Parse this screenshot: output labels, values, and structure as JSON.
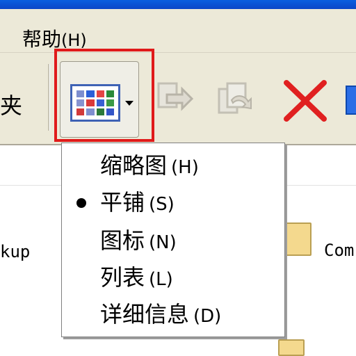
{
  "menubar": {
    "help_label": "帮助",
    "help_accel": "(H)"
  },
  "toolbar": {
    "folder_fragment": "夹",
    "views_icon": "views-grid-icon",
    "move_to_icon": "move-to-icon",
    "copy_to_icon": "copy-to-icon",
    "delete_icon": "delete-icon",
    "undo_icon": "undo-icon"
  },
  "views_menu": {
    "items": [
      {
        "label": "缩略图",
        "accel": "(H)",
        "selected": false
      },
      {
        "label": "平铺",
        "accel": "(S)",
        "selected": true
      },
      {
        "label": "图标",
        "accel": "(N)",
        "selected": false
      },
      {
        "label": "列表",
        "accel": "(L)",
        "selected": false
      },
      {
        "label": "详细信息",
        "accel": "(D)",
        "selected": false
      }
    ]
  },
  "content": {
    "left_fragment": "kup",
    "right_fragment": "Com"
  },
  "colors": {
    "highlight": "#e01a1a",
    "toolbar_bg": "#ece9d8",
    "delete_red": "#e02020"
  }
}
